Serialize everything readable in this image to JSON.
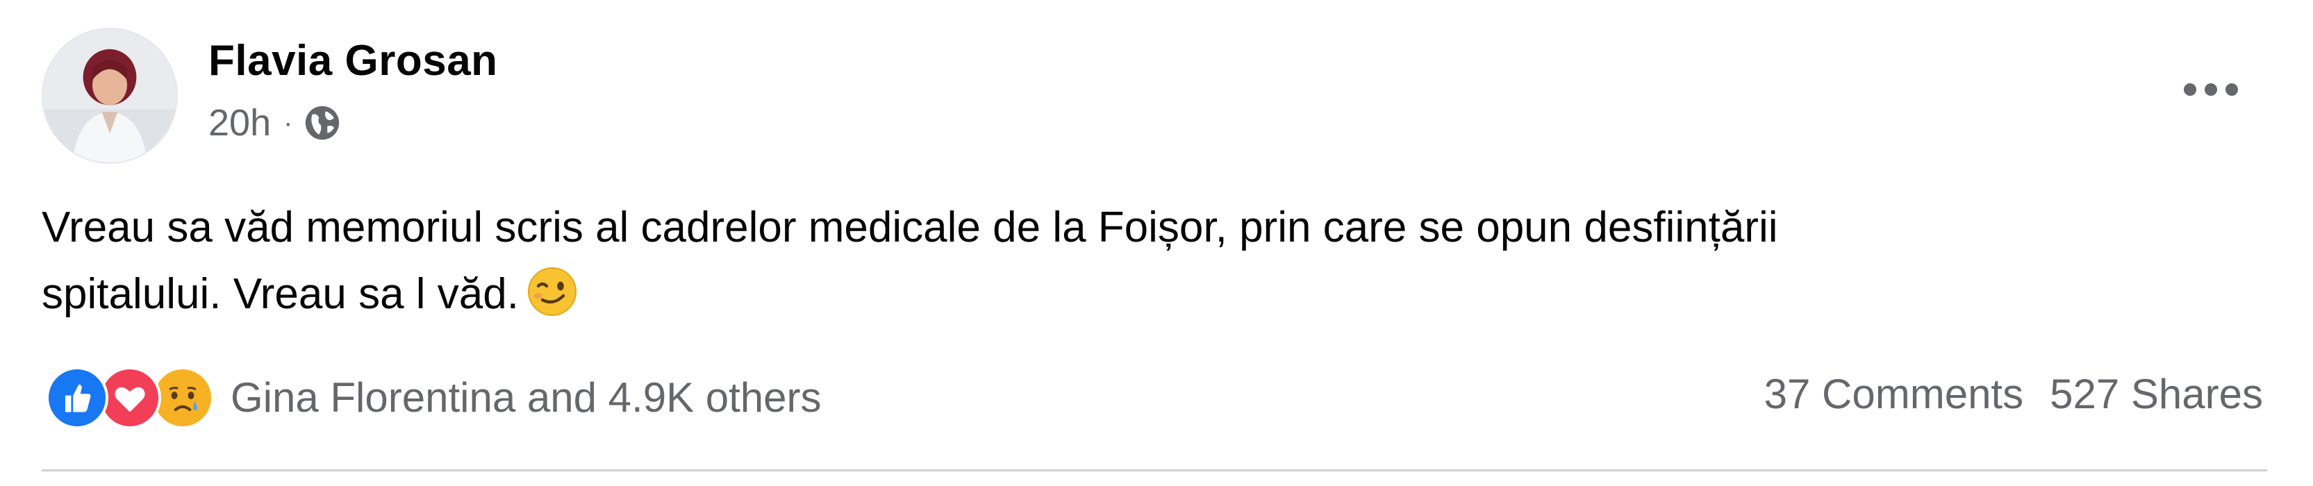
{
  "post": {
    "author": "Flavia Grosan",
    "time": "20h",
    "separator": "·",
    "privacy_icon": "globe-icon",
    "menu_icon": "more-options-icon",
    "text_line1": "Vreau sa văd memoriul scris al cadrelor medicale de la Foișor, prin care se opun desființării",
    "text_line2": "spitalului. Vreau sa l văd.",
    "emoji": "winking-face-emoji"
  },
  "footer": {
    "reaction_icons": [
      "like-icon",
      "love-icon",
      "sad-icon"
    ],
    "reactions_text": "Gina Florentina and 4.9K others",
    "comments": "37 Comments",
    "shares": "527 Shares"
  },
  "colors": {
    "like_blue": "#1877f2",
    "love_red": "#f33e58",
    "sad_yellow": "#f7b125",
    "secondary_text": "#65676b"
  }
}
